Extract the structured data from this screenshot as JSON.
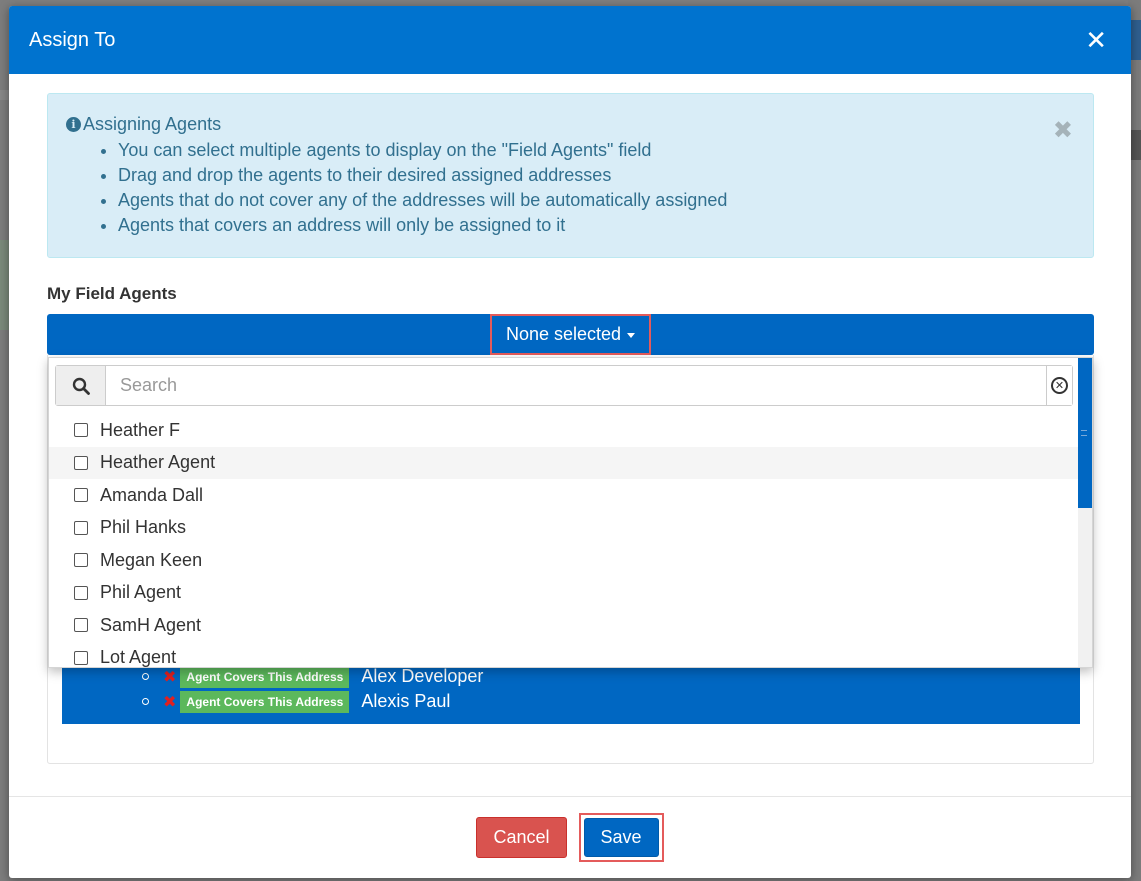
{
  "modal": {
    "title": "Assign To"
  },
  "alert": {
    "title": "Assigning Agents",
    "items": [
      "You can select multiple agents to display on the \"Field Agents\" field",
      "Drag and drop the agents to their desired assigned addresses",
      "Agents that do not cover any of the addresses will be automatically assigned",
      "Agents that covers an address will only be assigned to it"
    ]
  },
  "field_agents": {
    "label": "My Field Agents",
    "selected_label": "None selected",
    "search_placeholder": "Search",
    "options": [
      "Heather F",
      "Heather Agent",
      "Amanda Dall",
      "Phil Hanks",
      "Megan Keen",
      "Phil Agent",
      "SamH Agent",
      "Lot Agent"
    ]
  },
  "assigned": {
    "rows": [
      {
        "badge": "Agent Covers This Address",
        "name": "Alex Developer"
      },
      {
        "badge": "Agent Covers This Address",
        "name": "Alexis Paul"
      }
    ]
  },
  "footer": {
    "cancel_label": "Cancel",
    "save_label": "Save"
  },
  "colors": {
    "primary": "#0073cf",
    "danger": "#d9534f",
    "success": "#5cb85c",
    "info_bg": "#d9edf7"
  }
}
